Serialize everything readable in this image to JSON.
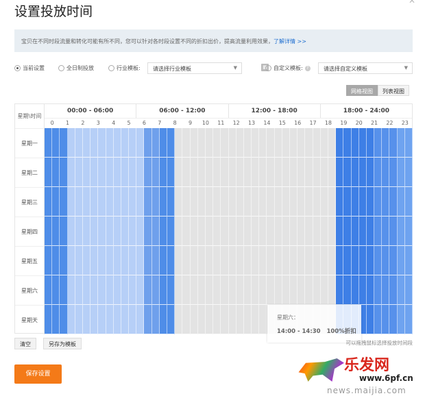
{
  "title": "设置投放时间",
  "notice": {
    "text": "宝贝在不同时段流量和转化可能有所不同，您可以针对各时段设置不同的折扣出价，提高流量利用效果，",
    "link": "了解详情 >>"
  },
  "options": {
    "current": "当前设置",
    "fullday": "全日制投放",
    "industry": "行业模板:",
    "industry_select": "请选择行业模板",
    "custom": "自定义模板:",
    "custom_select": "请选择自定义模板",
    "selected": "current"
  },
  "views": {
    "grid": "网格视图",
    "list": "列表视图",
    "active": "grid"
  },
  "grid": {
    "corner": "星期\\时间",
    "ranges": [
      "00:00 - 06:00",
      "06:00 - 12:00",
      "12:00 - 18:00",
      "18:00 - 24:00"
    ],
    "hours": [
      "0",
      "1",
      "2",
      "3",
      "4",
      "5",
      "6",
      "7",
      "8",
      "9",
      "10",
      "11",
      "12",
      "13",
      "14",
      "15",
      "16",
      "17",
      "18",
      "19",
      "20",
      "21",
      "22",
      "23"
    ],
    "days": [
      "星期一",
      "星期二",
      "星期三",
      "星期四",
      "星期五",
      "星期六",
      "星期天"
    ],
    "colors": {
      "dark": "#4f8de8",
      "medium": "#6fa0ec",
      "light": "#b6cff7",
      "off": "#e3e3e3",
      "eve1": "#3e7fe6",
      "eve2": "#5791eb",
      "eve3": "#6ea3f0"
    },
    "schedule": [
      {
        "start": "00:00",
        "end": "01:30",
        "level": "dark"
      },
      {
        "start": "01:30",
        "end": "06:30",
        "level": "light"
      },
      {
        "start": "06:30",
        "end": "07:30",
        "level": "medium"
      },
      {
        "start": "07:30",
        "end": "08:30",
        "level": "dark"
      },
      {
        "start": "08:30",
        "end": "19:00",
        "level": "off"
      },
      {
        "start": "19:00",
        "end": "21:30",
        "level": "eve1"
      },
      {
        "start": "21:30",
        "end": "23:00",
        "level": "eve2"
      },
      {
        "start": "23:00",
        "end": "24:00",
        "level": "eve3"
      }
    ]
  },
  "tooltip": {
    "day": "星期六：",
    "range": "14:00 - 14:30",
    "discount": "100%折扣"
  },
  "hint": "可以拖拽鼠标选择投放时间段",
  "buttons": {
    "clear": "清空",
    "save_template": "另存为模板",
    "save": "保存设置"
  },
  "watermark": {
    "logo": "乐发网",
    "url": "www.6pf.cn",
    "url2": "news.maijia.com"
  }
}
